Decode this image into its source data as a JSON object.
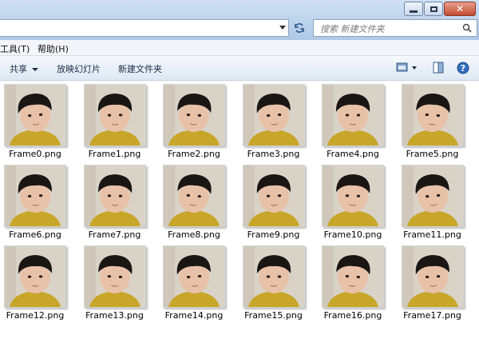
{
  "search": {
    "placeholder": "搜索 新建文件夹"
  },
  "menu": {
    "items": [
      "工具(T)",
      "帮助(H)"
    ]
  },
  "toolbar": {
    "share_label": "共享",
    "slideshow_label": "放映幻灯片",
    "new_folder_label": "新建文件夹"
  },
  "icons": {
    "view": "view-options-icon",
    "pane": "preview-pane-icon",
    "help": "help-icon",
    "refresh": "refresh-icon",
    "search": "search-icon"
  },
  "colors": {
    "shirt": "#c8a62a",
    "hair": "#1a1614",
    "skin": "#e8c2a8",
    "background": "#d9d3c7"
  },
  "files": [
    {
      "name": "Frame0.png"
    },
    {
      "name": "Frame1.png"
    },
    {
      "name": "Frame2.png"
    },
    {
      "name": "Frame3.png"
    },
    {
      "name": "Frame4.png"
    },
    {
      "name": "Frame5.png"
    },
    {
      "name": "Frame6.png"
    },
    {
      "name": "Frame7.png"
    },
    {
      "name": "Frame8.png"
    },
    {
      "name": "Frame9.png"
    },
    {
      "name": "Frame10.png"
    },
    {
      "name": "Frame11.png"
    },
    {
      "name": "Frame12.png"
    },
    {
      "name": "Frame13.png"
    },
    {
      "name": "Frame14.png"
    },
    {
      "name": "Frame15.png"
    },
    {
      "name": "Frame16.png"
    },
    {
      "name": "Frame17.png"
    }
  ]
}
